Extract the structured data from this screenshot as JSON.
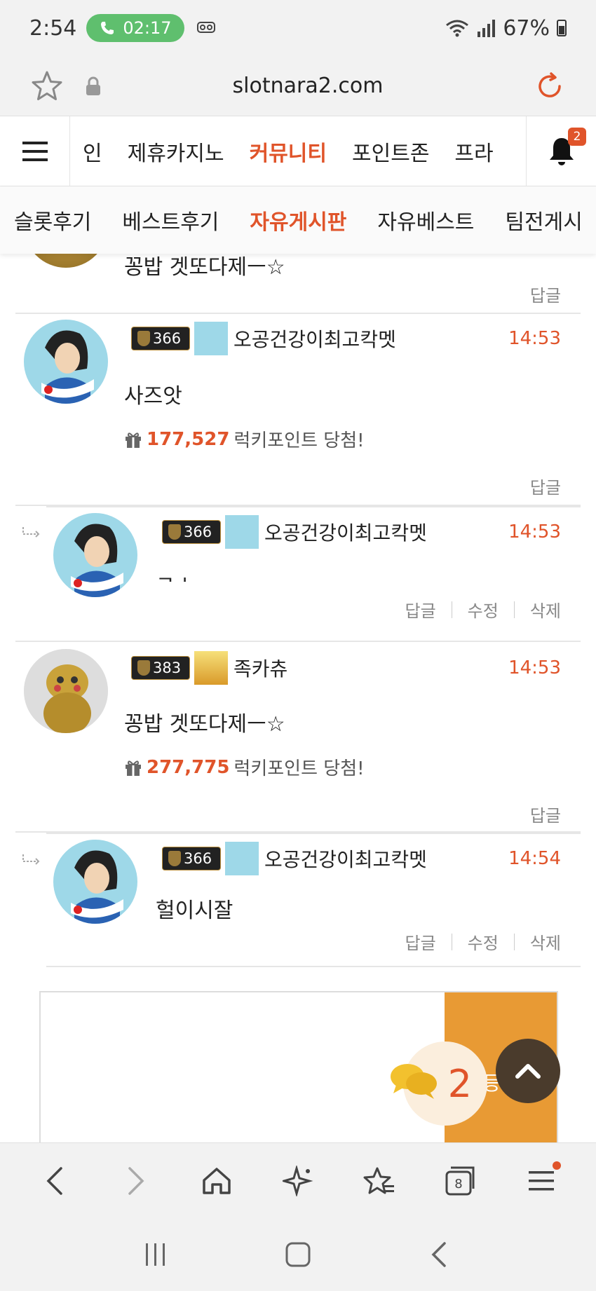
{
  "status_bar": {
    "time": "2:54",
    "call_timer": "02:17",
    "battery": "67%",
    "icons": [
      "phone-icon",
      "voicemail-icon",
      "wifi-icon",
      "signal-icon",
      "battery-icon"
    ]
  },
  "browser": {
    "url": "slotnara2.com",
    "tab_count": "8"
  },
  "main_nav": {
    "items": [
      {
        "label": "인"
      },
      {
        "label": "제휴카지노"
      },
      {
        "label": "커뮤니티"
      },
      {
        "label": "포인트존"
      },
      {
        "label": "프라"
      }
    ],
    "active_index": 2,
    "notification_count": "2"
  },
  "sub_nav": {
    "items": [
      {
        "label": "슬롯후기"
      },
      {
        "label": "베스트후기"
      },
      {
        "label": "자유게시판"
      },
      {
        "label": "자유베스트"
      },
      {
        "label": "팀전게시"
      }
    ],
    "active_index": 2
  },
  "comments": [
    {
      "partial_text": "꽁밥 겟또다제ㅡ☆",
      "reply_label": "답글"
    },
    {
      "level": "366",
      "nickname": "오공건강이최고칵멧",
      "time": "14:53",
      "text": "사즈앗",
      "lucky_points": "177,527",
      "lucky_suffix": "럭키포인트 당첨!",
      "reply_label": "답글"
    },
    {
      "is_reply": true,
      "level": "366",
      "nickname": "오공건강이최고칵멧",
      "time": "14:53",
      "text": "ㄱㅅ",
      "reply_label": "답글",
      "edit_label": "수정",
      "delete_label": "삭제"
    },
    {
      "level": "383",
      "nickname": "족카츄",
      "time": "14:53",
      "text": "꽁밥 겟또다제ㅡ☆",
      "lucky_points": "277,775",
      "lucky_suffix": "럭키포인트 당첨!",
      "reply_label": "답글"
    },
    {
      "is_reply": true,
      "level": "366",
      "nickname": "오공건강이최고칵멧",
      "time": "14:54",
      "text": "헐이시잘",
      "reply_label": "답글",
      "edit_label": "수정",
      "delete_label": "삭제"
    }
  ],
  "write_area": {
    "submit_label": "등록",
    "comment_count": "2"
  },
  "colors": {
    "accent": "#e0542a",
    "submit": "#e89a34",
    "scroll_top": "#4a3b2c"
  }
}
